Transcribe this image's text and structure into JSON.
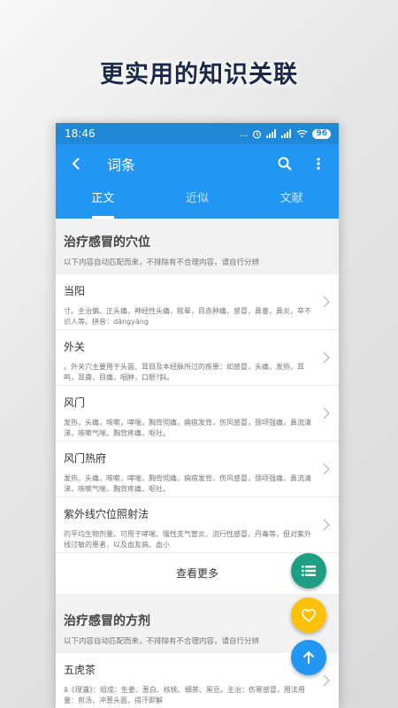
{
  "promo": {
    "title": "更实用的知识关联"
  },
  "status": {
    "time": "18:46",
    "dots": "...",
    "signal": "📶",
    "battery": "96"
  },
  "appbar": {
    "title": "词条",
    "icons": [
      "back-arrow-icon",
      "search-icon",
      "more-vert-icon"
    ]
  },
  "tabs": [
    {
      "label": "正文",
      "active": true
    },
    {
      "label": "近似",
      "active": false
    },
    {
      "label": "文献",
      "active": false
    }
  ],
  "section1": {
    "title": "治疗感冒的穴位",
    "subtitle": "以下内容自动匹配而来，不排除有不合理内容，请自行分辨",
    "items": [
      {
        "title": "当阳",
        "desc": "寸。主治偏、正头痛，神经性头痛，眩晕，目赤肿痛，感冒，鼻塞，鼻炎，卒不识人等。拼音：dāngyáng"
      },
      {
        "title": "外关",
        "desc": "。外关穴主要用于头面、耳目及本经脉所过的疾患：如感冒，头痛，发热，耳鸣，耳聋，目痛，咽肿，口眼?斜。"
      },
      {
        "title": "风门",
        "desc": "发热，头痛，咳嗽，哮喘，胸背彻痛，痈疽发背，伤风感冒，颈项强痛，鼻流清涕，咳嗽气喘，胸背疼痛，呕吐。"
      },
      {
        "title": "风门热府",
        "desc": "发热，头痛，咳嗽，哮喘，胸背彻痛，痈疽发背，伤风感冒，颈项强痛，鼻流清涕，咳嗽气喘，胸背疼痛，呕吐。"
      },
      {
        "title": "紫外线穴位照射法",
        "desc": "的平均生物剂量。可用于哮喘、慢性支气管炎、流行性感冒、丹毒等，但对紫外线过敏的患者，以及血友病、血小"
      }
    ],
    "more_label": "查看更多"
  },
  "section2": {
    "title": "治疗感冒的方剂",
    "subtitle": "以下内容自动匹配而来，不排除有不合理内容，请自行分辨",
    "items": [
      {
        "title": "五虎茶",
        "desc": "ā《理瀹》：组成：生姜、葱白、核桃、细茶、黑豆。主治：伤寒感冒，用法用量：煎汤，冲葱头面，得汗即解"
      }
    ]
  },
  "colors": {
    "primary": "#2196f3",
    "status": "#1f89d8",
    "fab_list": "#1e9e82",
    "fab_fav": "#ffc107",
    "fab_up": "#2196f3"
  },
  "fabs": [
    "list-icon",
    "heart-icon",
    "arrow-up-icon"
  ]
}
